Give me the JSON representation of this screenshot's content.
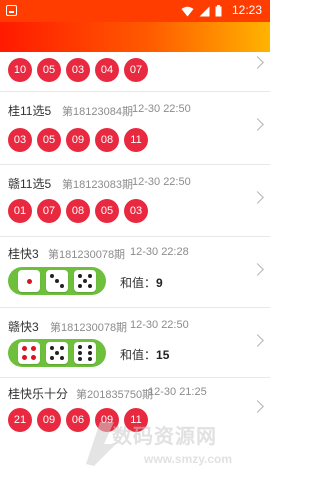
{
  "status_bar": {
    "time": "12:23"
  },
  "lottery_rows": [
    {
      "name": "",
      "issue": "",
      "time": "",
      "balls": [
        "10",
        "05",
        "03",
        "04",
        "07"
      ]
    },
    {
      "name": "桂11选5",
      "issue": "第18123084期",
      "time": "12-30 22:50",
      "balls": [
        "03",
        "05",
        "09",
        "08",
        "11"
      ]
    },
    {
      "name": "赣11选5",
      "issue": "第18123083期",
      "time": "12-30 22:50",
      "balls": [
        "01",
        "07",
        "08",
        "05",
        "03"
      ]
    },
    {
      "name": "桂快3",
      "issue": "第181230078期",
      "time": "12-30 22:28",
      "dice": [
        1,
        3,
        5
      ],
      "sum_label": "和值：",
      "sum_value": "9"
    },
    {
      "name": "赣快3",
      "issue": "第181230078期",
      "time": "12-30 22:50",
      "dice": [
        4,
        5,
        6
      ],
      "sum_label": "和值：",
      "sum_value": "15"
    },
    {
      "name": "桂快乐十分",
      "issue": "第201835750期",
      "time": "12-30 21:25",
      "balls": [
        "21",
        "09",
        "06",
        "09",
        "11"
      ]
    }
  ],
  "watermark": {
    "text": "数码资源网",
    "url": "www.smzy.com"
  },
  "colors": {
    "ball": "#e8293f",
    "dice_box": "#6ec03c",
    "header_start": "#ff1a00",
    "header_end": "#ffb400"
  }
}
